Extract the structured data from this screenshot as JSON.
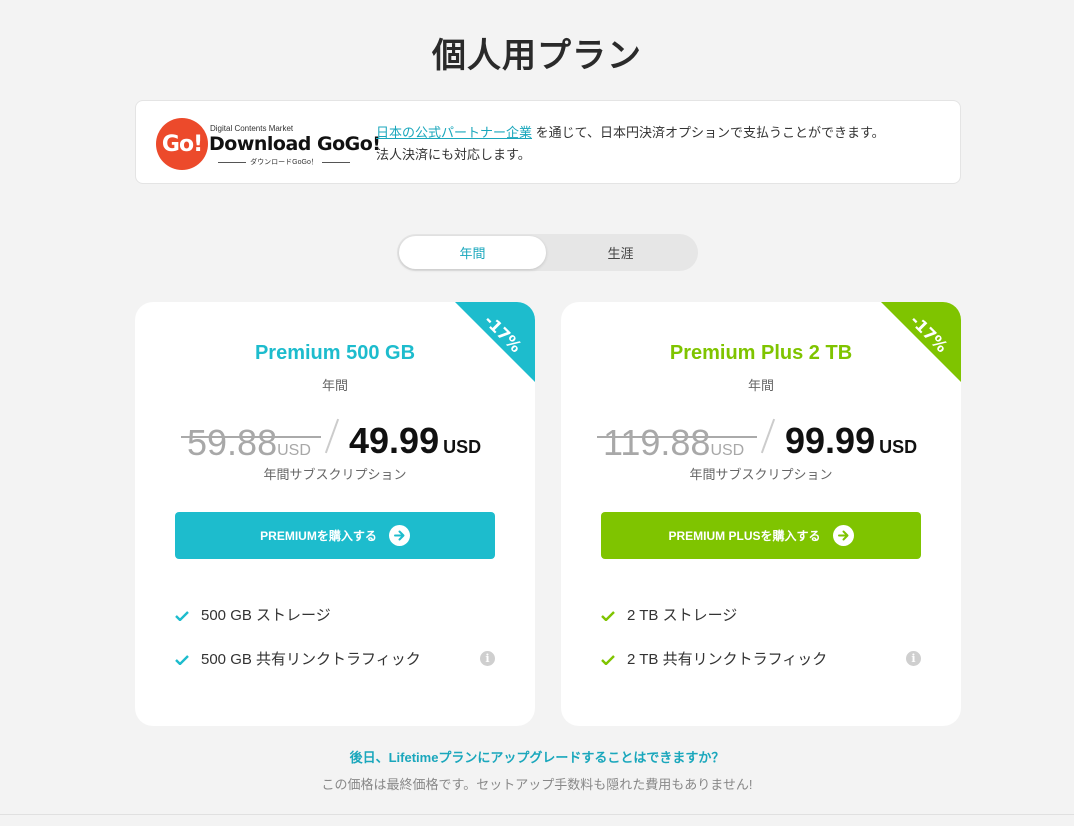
{
  "page": {
    "title": "個人用プラン"
  },
  "partner": {
    "logo_go": "Go!",
    "logo_small": "Digital Contents Market",
    "logo_big": "Download GoGo!",
    "logo_sub": "ダウンロードGoGo！",
    "link_text": "日本の公式パートナー企業",
    "text_line1": " を通じて、日本円決済オプションで支払うことができます。",
    "text_line2": "法人決済にも対応します。"
  },
  "billing_toggle": {
    "options": [
      {
        "label": "年間",
        "active": true
      },
      {
        "label": "生涯",
        "active": false
      }
    ]
  },
  "plans": [
    {
      "name": "Premium 500 GB",
      "period": "年間",
      "discount": "-17%",
      "old_price": "59.88",
      "old_unit": "USD",
      "new_price": "49.99",
      "new_unit": "USD",
      "caption": "年間サブスクリプション",
      "button_label": "PREMIUMを購入する",
      "color": "#1dbccd",
      "features": [
        "500 GB ストレージ",
        "500 GB 共有リンクトラフィック"
      ]
    },
    {
      "name": "Premium Plus 2 TB",
      "period": "年間",
      "discount": "-17%",
      "old_price": "119.88",
      "old_unit": "USD",
      "new_price": "99.99",
      "new_unit": "USD",
      "caption": "年間サブスクリプション",
      "button_label": "PREMIUM PLUSを購入する",
      "color": "#7fc400",
      "features": [
        "2 TB ストレージ",
        "2 TB 共有リンクトラフィック"
      ]
    }
  ],
  "faq": {
    "link_text": "後日、Lifetimeプランにアップグレードすることはできますか？",
    "footnote": "この価格は最終価格です。セットアップ手数料も隠れた費用もありません!"
  },
  "icons": {
    "arrow": "arrow-right-circle-icon",
    "check": "check-icon",
    "info": "info-icon"
  }
}
